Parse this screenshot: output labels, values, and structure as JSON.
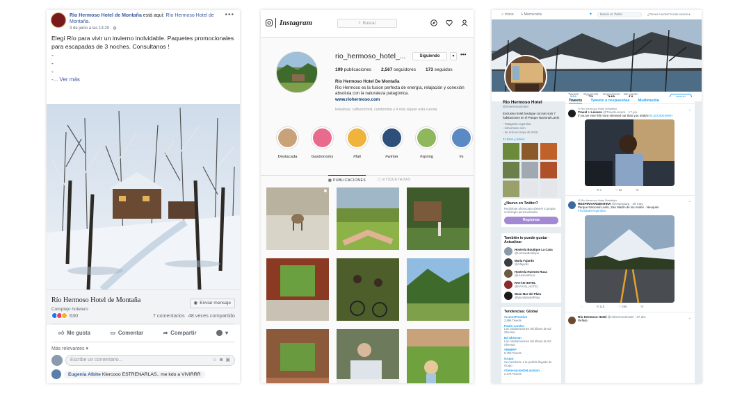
{
  "facebook": {
    "page_name": "Río Hermoso Hotel de Montaña",
    "post_action": "está aquí:",
    "location": "Río Hermoso Hotel de Montaña.",
    "date": "3 de junio a las 13:20 ·",
    "post_text": "Elegí Río para vivir un invierno inolvidable. Paquetes promocionales para escapadas de 3 noches. Consultanos !\n-\n-\n-",
    "see_more": "-... Ver más",
    "card_title": "Río Hermoso Hotel de Montaña",
    "card_subtitle": "Complejo hotelero",
    "send_message": "Enviar mensaje",
    "reactions_count": "630",
    "comments_count": "7 comentarios",
    "shares_count": "48 veces compartido",
    "like_label": "Me gusta",
    "comment_label": "Comentar",
    "share_label": "Compartir",
    "sort_label": "Más relevantes ▾",
    "comment_placeholder": "Escribe un comentario...",
    "first_comment_author": "Eugenia Albite",
    "first_comment_text": "Klercooo ESTRENARLAS.. me kdo a VIVIRRR",
    "colors": {
      "link": "#385898",
      "like": "#1877f2",
      "love": "#f33e58",
      "haha": "#f7b125"
    }
  },
  "instagram": {
    "logo": "Instagram",
    "search_placeholder": "Buscar",
    "username": "rio_hermoso_hotel_...",
    "follow_label": "Siguiendo",
    "posts": "199",
    "posts_label": "publicaciones",
    "followers": "2,567",
    "followers_label": "seguidores",
    "following": "173",
    "following_label": "seguidos",
    "bio_name": "Rio Hermoso Hotel De Montaña",
    "bio_text": "Rio Hermoso es la fusion perfecta de energía, relajación y conexión absoluta con la naturaleza patagónica.",
    "bio_url": "www.riohermoso.com",
    "followed_by": "ledsalvas, caffucinitonit, candomirta y 4 más siguen esta cuenta",
    "highlights": [
      {
        "label": "Destacada",
        "color": "#c9a27a"
      },
      {
        "label": "Gastronomy",
        "color": "#e86a8d"
      },
      {
        "label": "#fall",
        "color": "#f0b43c"
      },
      {
        "label": "#winter",
        "color": "#2d4f7a"
      },
      {
        "label": "#spring",
        "color": "#8fb85c"
      },
      {
        "label": "#s",
        "color": "#5b89c4"
      }
    ],
    "tab_posts": "PUBLICACIONES",
    "tab_tagged": "ETIQUETADAS"
  },
  "twitter": {
    "nav_home": "Inicio",
    "nav_moments": "Momentos",
    "nav_search": "Buscar en Twitter",
    "nav_account": "¿Tienes cuenta? Iniciar sesión ▾",
    "stats": [
      {
        "label": "Tweets",
        "value": "331"
      },
      {
        "label": "Siguiendo",
        "value": "73"
      },
      {
        "label": "Seguidores",
        "value": "248"
      },
      {
        "label": "Me gusta",
        "value": "14"
      }
    ],
    "follow_label": "Seguir",
    "profile_name": "Rio Hermoso Hotel",
    "handle": "@riohermosohotel",
    "bio": "Exclusivo hotel boutique con tan solo 7 habitaciones en el Parque Nacional Lanín",
    "meta": [
      "Patagonia Argentina",
      "riohermoso.com",
      "Se unió en mayo de 2016"
    ],
    "photos_label": "31 fotos y videos",
    "new_title": "¿Nuevo en Twitter?",
    "new_text": "Regístrate ahora para obtener tu propia cronología personalizada!",
    "register_label": "Regístrate",
    "wtf_title": "También te puede gustar · Actualizar",
    "wtf": [
      {
        "name": "Hostería Boutique La Casa",
        "handle": "@LaCasaBoutique"
      },
      {
        "name": "María Fajardo",
        "handle": "@mfajardo"
      },
      {
        "name": "Hostería Huemes Ruca",
        "handle": "@HuemesRuca"
      },
      {
        "name": "RAYÁN HOTEL",
        "handle": "@RAYAN_HOTEL"
      },
      {
        "name": "Wum Mar del Plata",
        "handle": "@WumMardelPlata"
      }
    ],
    "trends_title": "Tendencias: Global",
    "trends": [
      {
        "tag": "#LunesPositivo",
        "count": "2.896 Tweets"
      },
      {
        "tag": "Paulo Londra",
        "count": "Las colaboraciones del álbum de Ed Sheeran"
      },
      {
        "tag": "Ed Sheeran",
        "count": "Las colaboraciones del álbum de Ed Sheeran"
      },
      {
        "tag": "#BeBRP",
        "count": "8.750 Tweets"
      },
      {
        "tag": "Grupo",
        "count": "Se mezclaron a la posible llegada de Grupo"
      },
      {
        "tag": "#GeneracionDeLaUnion",
        "count": "2.175 Tweets"
      }
    ],
    "tab_tweets": "Tweets",
    "tab_replies": "Tweets y respuestas",
    "tab_media": "Multimedia",
    "tweet1_rt": "Rio Hermoso Hotel Retwitteó",
    "tweet1_name": "Travel + Leisure",
    "tweet1_handle": "@TravelLeisure · 17 jun.",
    "tweet1_text": "If you've ever felt more stressed out than you realize",
    "tweet1_link": "bit.ly/2JiDEWWH",
    "tweet1_retweets": "4",
    "tweet1_likes": "32",
    "tweet2_rt": "Rio Hermoso Hotel Retwitteó",
    "tweet2_name": "RESPIRAARGENTINA",
    "tweet2_handle": "@respiraarg · 29 may.",
    "tweet2_text": "Parque Nacional Lanín, San Martín de los Andes · Neuquén",
    "tweet2_tag": "#TuristaEnArgentina",
    "tweet2_retweets": "118",
    "tweet2_likes": "498",
    "tweet3_name": "Rio Hermoso Hotel",
    "tweet3_handle": "@riohermosohotel · 27 abr.",
    "tweet3_text": "Refleja",
    "colors": {
      "accent": "#1da1f2",
      "register": "#a389d4"
    }
  }
}
